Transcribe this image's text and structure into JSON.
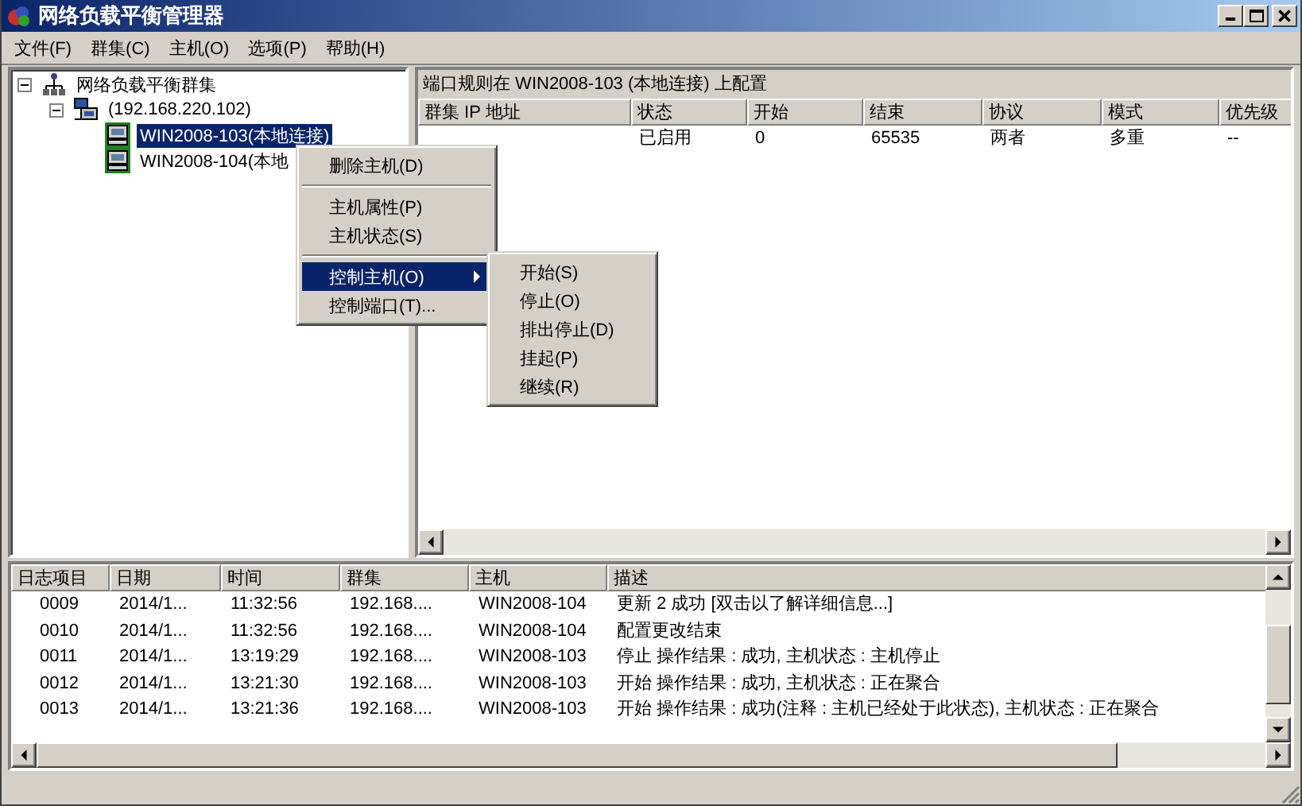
{
  "window": {
    "title": "网络负载平衡管理器"
  },
  "menu_bar": [
    {
      "label": "文件(F)"
    },
    {
      "label": "群集(C)"
    },
    {
      "label": "主机(O)"
    },
    {
      "label": "选项(P)"
    },
    {
      "label": "帮助(H)"
    }
  ],
  "tree": [
    {
      "label": "网络负载平衡群集",
      "kind": "cluster-root",
      "expanded": true,
      "children": [
        {
          "label": "(192.168.220.102)",
          "kind": "cluster",
          "expanded": true,
          "children": [
            {
              "label": "WIN2008-103(本地连接)",
              "kind": "host",
              "selected": true
            },
            {
              "label": "WIN2008-104(本地",
              "kind": "host",
              "selected": false
            }
          ]
        }
      ]
    }
  ],
  "port_rules": {
    "title": "端口规则在 WIN2008-103 (本地连接) 上配置",
    "columns": [
      "群集 IP 地址",
      "状态",
      "开始",
      "结束",
      "协议",
      "模式",
      "优先级"
    ],
    "rows": [
      {
        "status": "已启用",
        "start": "0",
        "end": "65535",
        "protocol": "两者",
        "mode": "多重",
        "priority": "--"
      }
    ]
  },
  "context_menu": {
    "items": [
      {
        "kind": "item",
        "label": "删除主机(D)",
        "selected": false
      },
      {
        "kind": "separator"
      },
      {
        "kind": "item",
        "label": "主机属性(P)",
        "selected": false
      },
      {
        "kind": "item",
        "label": "主机状态(S)",
        "selected": false
      },
      {
        "kind": "separator"
      },
      {
        "kind": "submenu",
        "label": "控制主机(O)",
        "selected": true
      },
      {
        "kind": "item",
        "label": "控制端口(T)...",
        "selected": false
      }
    ],
    "submenu": [
      {
        "label": "开始(S)"
      },
      {
        "label": "停止(O)"
      },
      {
        "label": "排出停止(D)"
      },
      {
        "label": "挂起(P)"
      },
      {
        "label": "继续(R)"
      }
    ]
  },
  "log": {
    "columns": [
      "日志项目",
      "日期",
      "时间",
      "群集",
      "主机",
      "描述"
    ],
    "rows": [
      [
        "0009",
        "2014/1...",
        "11:32:56",
        "192.168....",
        "WIN2008-104",
        "更新 2 成功 [双击以了解详细信息...]"
      ],
      [
        "0010",
        "2014/1...",
        "11:32:56",
        "192.168....",
        "WIN2008-104",
        "配置更改结束"
      ],
      [
        "0011",
        "2014/1...",
        "13:19:29",
        "192.168....",
        "WIN2008-103",
        "停止 操作结果 : 成功, 主机状态 : 主机停止"
      ],
      [
        "0012",
        "2014/1...",
        "13:21:30",
        "192.168....",
        "WIN2008-103",
        "开始 操作结果 : 成功, 主机状态 : 正在聚合"
      ],
      [
        "0013",
        "2014/1...",
        "13:21:36",
        "192.168....",
        "WIN2008-103",
        "开始 操作结果 : 成功(注释 : 主机已经处于此状态), 主机状态 : 正在聚合"
      ]
    ]
  }
}
